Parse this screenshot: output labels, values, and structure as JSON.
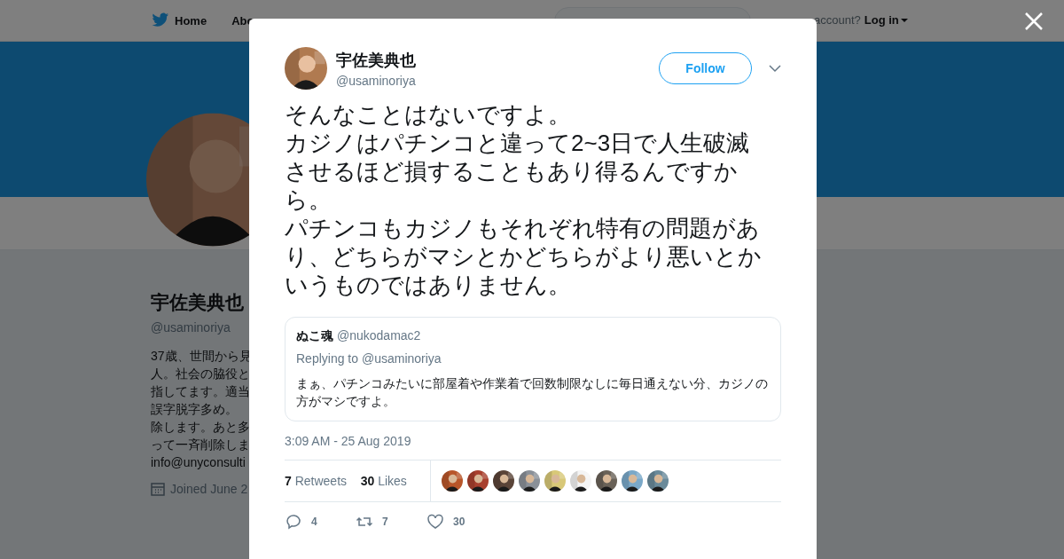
{
  "header": {
    "nav": [
      {
        "label": "Home"
      },
      {
        "label": "Abo"
      }
    ],
    "account_prompt": "account?",
    "login": "Log in"
  },
  "profile": {
    "name": "宇佐美典也",
    "handle": "@usaminoriya",
    "bio_lines": [
      "37歳、世間から見",
      "人。社会の脇役と",
      "指してます。適当",
      "誤字脱字多め。",
      "除します。あと多",
      "って一斉削除しま",
      "info@unyconsulti"
    ],
    "joined": "Joined June 2"
  },
  "tweet": {
    "author": "宇佐美典也",
    "handle": "@usaminoriya",
    "follow": "Follow",
    "paragraphs": [
      "そんなことはないですよ。",
      "カジノはパチンコと違って2~3日で人生破滅させるほど損することもあり得るんですから。",
      "パチンコもカジノもそれぞれ特有の問題があり、どちらがマシとかどちらがより悪いとかいうものではありません。"
    ],
    "quote": {
      "author": "ぬこ魂",
      "handle": "@nukodamac2",
      "replying": "Replying to @usaminoriya",
      "text": "まぁ、パチンコみたいに部屋着や作業着で回数制限なしに毎日通えない分、カジノの方がマシですよ。"
    },
    "time": "3:09 AM - 25 Aug 2019",
    "stats": [
      {
        "count": "7",
        "label": "Retweets"
      },
      {
        "count": "30",
        "label": "Likes"
      }
    ],
    "actions": [
      {
        "kind": "reply",
        "count": "4"
      },
      {
        "kind": "retweet",
        "count": "7"
      },
      {
        "kind": "like",
        "count": "30"
      }
    ]
  }
}
